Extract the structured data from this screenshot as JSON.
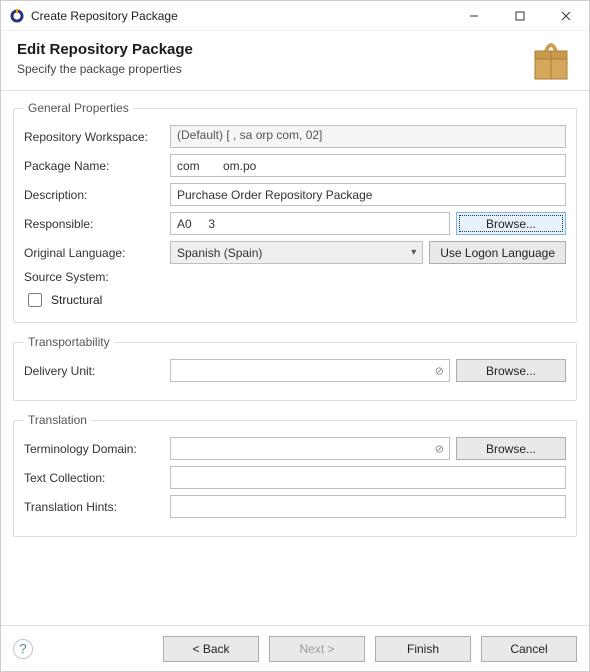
{
  "titlebar": {
    "title": "Create Repository Package"
  },
  "header": {
    "heading": "Edit Repository Package",
    "sub": "Specify the package properties"
  },
  "general": {
    "legend": "General Properties",
    "workspace_label": "Repository Workspace:",
    "workspace_value": "(Default) [   , sa        orp    com, 02]",
    "name_label": "Package Name:",
    "name_value": "com       om.po",
    "desc_label": "Description:",
    "desc_value": "Purchase Order Repository Package",
    "resp_label": "Responsible:",
    "resp_value": "A0     3",
    "resp_browse": "Browse...",
    "lang_label": "Original Language:",
    "lang_value": "Spanish (Spain)",
    "lang_logon": "Use Logon Language",
    "src_label": "Source System:",
    "src_value": "   ",
    "structural_label": "Structural"
  },
  "transport": {
    "legend": "Transportability",
    "du_label": "Delivery Unit:",
    "du_value": "",
    "du_browse": "Browse..."
  },
  "translation": {
    "legend": "Translation",
    "term_label": "Terminology Domain:",
    "term_value": "",
    "term_browse": "Browse...",
    "text_label": "Text Collection:",
    "text_value": "",
    "hints_label": "Translation Hints:",
    "hints_value": ""
  },
  "footer": {
    "back": "< Back",
    "next": "Next >",
    "finish": "Finish",
    "cancel": "Cancel"
  }
}
